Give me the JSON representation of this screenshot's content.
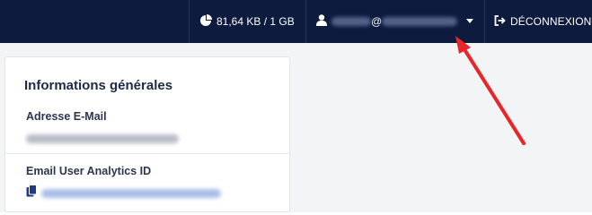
{
  "topbar": {
    "storage_usage": "81,64 KB / 1 GB",
    "storage_icon": "pie-chart-icon",
    "user_email_at": "@",
    "user_icon": "user-icon",
    "user_menu_icon": "caret-down-icon",
    "logout_label": "DÉCONNEXION",
    "logout_icon": "sign-out-icon",
    "background_color": "#0d1b3e"
  },
  "card": {
    "title": "Informations générales",
    "fields": [
      {
        "label": "Adresse E-Mail"
      },
      {
        "label": "Email User Analytics ID",
        "copy_icon": "copy-icon"
      }
    ]
  },
  "annotation": {
    "arrow_color": "#e8262a"
  }
}
